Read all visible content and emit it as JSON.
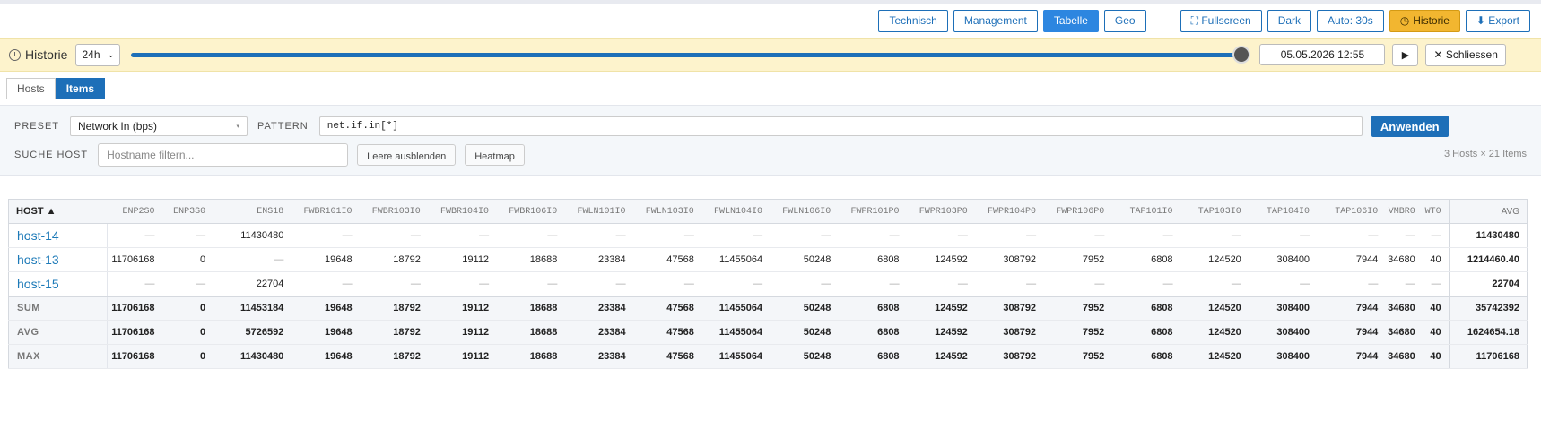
{
  "toolbar": {
    "buttons": [
      {
        "label": "Technisch",
        "active": false
      },
      {
        "label": "Management",
        "active": false
      },
      {
        "label": "Tabelle",
        "active": true
      },
      {
        "label": "Geo",
        "active": false
      }
    ],
    "fullscreen_label": "⛶ Fullscreen",
    "dark_label": "Dark",
    "auto_label": "Auto: 30s",
    "history_label": "Historie",
    "export_label": "⬇ Export"
  },
  "history": {
    "title": "Historie",
    "range_value": "24h",
    "slider_fraction": 1.0,
    "datetime": "05.05.2026 12:55",
    "play_label": "▶",
    "close_label": "✕ Schliessen"
  },
  "tabs": [
    {
      "label": "Hosts",
      "active": false
    },
    {
      "label": "Items",
      "active": true
    }
  ],
  "filters": {
    "preset_label": "PRESET",
    "preset_value": "Network In (bps)",
    "pattern_label": "PATTERN",
    "pattern_value": "net.if.in[*]",
    "apply_label": "Anwenden",
    "search_label": "SUCHE HOST",
    "search_placeholder": "Hostname filtern...",
    "hide_empty_label": "Leere ausblenden",
    "heatmap_label": "Heatmap",
    "summary": "3 Hosts × 21 Items"
  },
  "table": {
    "host_header": "HOST ▲",
    "avg_header": "AVG",
    "columns": [
      "ENP2S0",
      "ENP3S0",
      "ENS18",
      "FWBR101I0",
      "FWBR103I0",
      "FWBR104I0",
      "FWBR106I0",
      "FWLN101I0",
      "FWLN103I0",
      "FWLN104I0",
      "FWLN106I0",
      "FWPR101P0",
      "FWPR103P0",
      "FWPR104P0",
      "FWPR106P0",
      "TAP101I0",
      "TAP103I0",
      "TAP104I0",
      "TAP106I0",
      "VMBR0",
      "WT0"
    ],
    "rows": [
      {
        "host": "host-14",
        "values": [
          "—",
          "—",
          "11430480",
          "—",
          "—",
          "—",
          "—",
          "—",
          "—",
          "—",
          "—",
          "—",
          "—",
          "—",
          "—",
          "—",
          "—",
          "—",
          "—",
          "—",
          "—"
        ],
        "avg": "11430480"
      },
      {
        "host": "host-13",
        "values": [
          "11706168",
          "0",
          "—",
          "19648",
          "18792",
          "19112",
          "18688",
          "23384",
          "47568",
          "11455064",
          "50248",
          "6808",
          "124592",
          "308792",
          "7952",
          "6808",
          "124520",
          "308400",
          "7944",
          "34680",
          "40"
        ],
        "avg": "1214460.40"
      },
      {
        "host": "host-15",
        "values": [
          "—",
          "—",
          "22704",
          "—",
          "—",
          "—",
          "—",
          "—",
          "—",
          "—",
          "—",
          "—",
          "—",
          "—",
          "—",
          "—",
          "—",
          "—",
          "—",
          "—",
          "—"
        ],
        "avg": "22704"
      }
    ],
    "aggregates": [
      {
        "label": "SUM",
        "values": [
          "11706168",
          "0",
          "11453184",
          "19648",
          "18792",
          "19112",
          "18688",
          "23384",
          "47568",
          "11455064",
          "50248",
          "6808",
          "124592",
          "308792",
          "7952",
          "6808",
          "124520",
          "308400",
          "7944",
          "34680",
          "40"
        ],
        "avg": "35742392"
      },
      {
        "label": "AVG",
        "values": [
          "11706168",
          "0",
          "5726592",
          "19648",
          "18792",
          "19112",
          "18688",
          "23384",
          "47568",
          "11455064",
          "50248",
          "6808",
          "124592",
          "308792",
          "7952",
          "6808",
          "124520",
          "308400",
          "7944",
          "34680",
          "40"
        ],
        "avg": "1624654.18"
      },
      {
        "label": "MAX",
        "values": [
          "11706168",
          "0",
          "11430480",
          "19648",
          "18792",
          "19112",
          "18688",
          "23384",
          "47568",
          "11455064",
          "50248",
          "6808",
          "124592",
          "308792",
          "7952",
          "6808",
          "124520",
          "308400",
          "7944",
          "34680",
          "40"
        ],
        "avg": "11706168"
      }
    ]
  }
}
